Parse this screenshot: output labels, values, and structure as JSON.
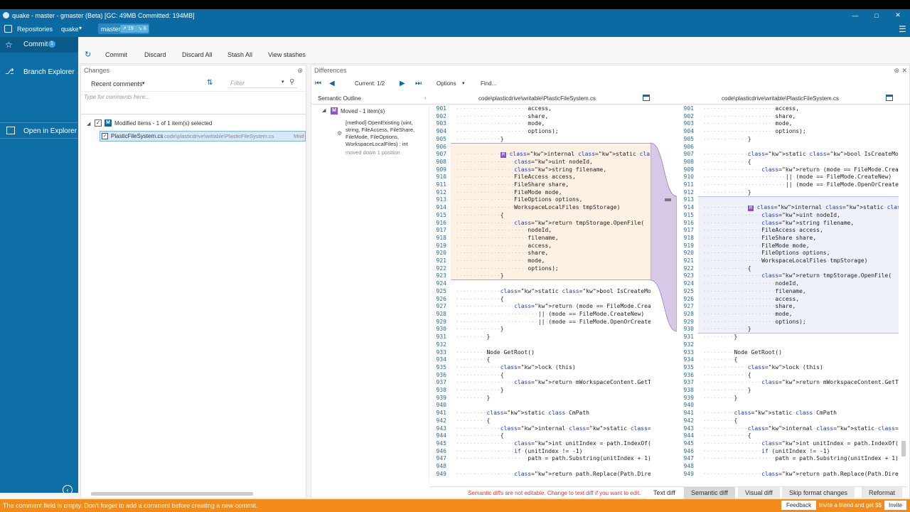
{
  "window": {
    "title": "quake - master - gmaster (Beta) [GC: 49MB Committed: 194MB]"
  },
  "top": {
    "repositories": "Repositories",
    "repo": "quake",
    "branch": "master",
    "badge_out": "19",
    "badge_in": "8"
  },
  "sidebar": {
    "commit": "Commit",
    "commit_count": "1",
    "branch_explorer": "Branch Explorer",
    "open_in_explorer": "Open in Explorer"
  },
  "actions": {
    "commit": "Commit",
    "discard": "Discard",
    "discard_all": "Discard All",
    "stash_all": "Stash All",
    "view_stashes": "View stashes"
  },
  "changes": {
    "title": "Changes",
    "recent_comments": "Recent comments",
    "filter_placeholder": "Filter",
    "comment_placeholder": "Type for comments here...",
    "group_label": "Modified items - 1 of 1 item(s) selected",
    "file_name": "PlasticFileSystem.cs",
    "file_path": "code\\plasticdrive\\writable\\PlasticFileSystem.cs",
    "file_status": "Mod"
  },
  "differences": {
    "title": "Differences",
    "current": "Current: 1/2",
    "options": "Options",
    "find": "Find...",
    "semantic_outline": "Semantic Outline",
    "left_path": "code\\plasticdrive\\writable\\PlasticFileSystem.cs",
    "right_path": "code\\plasticdrive\\writable\\PlasticFileSystem.cs",
    "outline_moved": "Moved - 1 item(s)",
    "outline_method": "[method] OpenExisting (uint, string, FileAccess, FileShare, FileMode, FileOptions, WorkspaceLocalFiles) : int",
    "outline_note": "moved down 1 position",
    "notice": "Semantic diffs are not editable. Change to text diff if you want to edit.",
    "tabs": [
      "Text diff",
      "Semantic diff",
      "Visual diff",
      "Skip format changes",
      "Reformat"
    ]
  },
  "left_code": {
    "start": 901,
    "lines": [
      "·····················access,",
      "·····················share,",
      "·····················mode,",
      "·····················options);",
      "·············}",
      "",
      "·············M·internal·static·int·OpenExisting(",
      "·················uint·nodeId,",
      "·················string·filename,",
      "·················FileAccess·access,",
      "·················FileShare·share,",
      "·················FileMode·mode,",
      "·················FileOptions·options,",
      "·················WorkspaceLocalFiles·tmpStorage)",
      "·············{",
      "·················return·tmpStorage.OpenFile(",
      "·····················nodeId,",
      "·····················filename,",
      "·····················access,",
      "·····················share,",
      "·····················mode,",
      "·····················options);",
      "·············}",
      "",
      "·············static·bool·IsCreateMode(FileMode·mode)",
      "·············{",
      "·················return·(mode·==·FileMode.Create)",
      "························||·(mode·==·FileMode.CreateNew)",
      "························||·(mode·==·FileMode.OpenOrCreate);",
      "·············}",
      "·········}",
      "",
      "·········Node·GetRoot()",
      "·········{",
      "·············lock·(this)",
      "·············{",
      "·················return·mWorkspaceContent.GetTree();",
      "·············}",
      "·········}",
      "",
      "·········static·class·CmPath",
      "·········{",
      "·············internal·static·string·FromWindows(string·path)",
      "·············{",
      "·················int·unitIndex·=·path.IndexOf(\":\");",
      "·················if·(unitIndex·!=·-1)",
      "·····················path·=·path.Substring(unitIndex·+·1);",
      "",
      "·················return·path.Replace(Path.DirectorySeparator"
    ]
  },
  "right_code": {
    "start": 901,
    "lines": [
      "·····················access,",
      "·····················share,",
      "·····················mode,",
      "·····················options);",
      "·············}",
      "",
      "·············static·bool·IsCreateMode(FileMode·mode)",
      "·············{",
      "·················return·(mode·==·FileMode.Create)",
      "························||·(mode·==·FileMode.CreateNew)",
      "························||·(mode·==·FileMode.OpenOrCreate);",
      "·············}",
      "",
      "·············M·internal·static·int·OpenExisting(",
      "·················uint·nodeId,",
      "·················string·filename,",
      "·················FileAccess·access,",
      "·················FileShare·share,",
      "·················FileMode·mode,",
      "·················FileOptions·options,",
      "·················WorkspaceLocalFiles·tmpStorage)",
      "·············{",
      "·················return·tmpStorage.OpenFile(",
      "·····················nodeId,",
      "·····················filename,",
      "·····················access,",
      "·····················share,",
      "·····················mode,",
      "·····················options);",
      "·············}",
      "·········}",
      "",
      "·········Node·GetRoot()",
      "·········{",
      "·············lock·(this)",
      "·············{",
      "·················return·mWorkspaceContent.GetTree();",
      "·············}",
      "·········}",
      "",
      "·········static·class·CmPath",
      "·········{",
      "·············internal·static·string·FromWindows(string·path)",
      "·············{",
      "·················int·unitIndex·=·path.IndexOf(\":\");",
      "·················if·(unitIndex·!=·-1)",
      "·····················path·=·path.Substring(unitIndex·+·1);",
      "",
      "·················return·path.Replace(Path.DirectorySeparator"
    ]
  },
  "status": {
    "message": "The comment field is empty. Don't forget to add a comment before creating a new commit.",
    "feedback": "Feedback",
    "invite_text": "Invite a friend and get $$",
    "invite": "Invite"
  },
  "colors": {
    "accent": "#0b6aa1",
    "sidebar": "#0e6ea6",
    "moved_left": "#fdf1e3",
    "moved_right": "#eef1fa",
    "moved_link": "#d8c8e8",
    "status": "#f28b1a"
  }
}
